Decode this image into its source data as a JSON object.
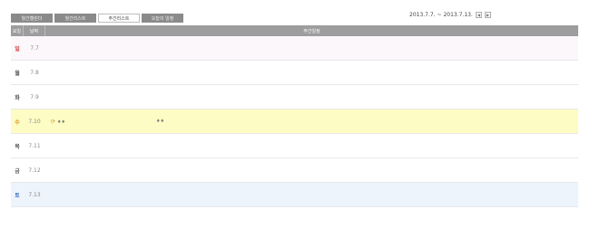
{
  "tabs": [
    {
      "label": "월간캘린더",
      "active": false
    },
    {
      "label": "월간리스트",
      "active": false
    },
    {
      "label": "주간리스트",
      "active": true
    },
    {
      "label": "오늘의 일정",
      "active": false
    }
  ],
  "range": {
    "text": "2013.7.7. ~ 2013.7.13.",
    "prev_icon": "chevron-left",
    "next_icon": "chevron-right"
  },
  "table": {
    "headers": {
      "dow": "요일",
      "date": "날짜",
      "schedule": "주간일정"
    },
    "rows": [
      {
        "dow": "일",
        "date": "7.7",
        "color": "#d33c3c",
        "bg": "sun"
      },
      {
        "dow": "월",
        "date": "7.8",
        "color": "#555555",
        "bg": "none"
      },
      {
        "dow": "화",
        "date": "7.9",
        "color": "#555555",
        "bg": "none"
      },
      {
        "dow": "수",
        "date": "7.10",
        "color": "#e08a1a",
        "bg": "today",
        "event1": "♦♦",
        "event2": "♦♦"
      },
      {
        "dow": "목",
        "date": "7.11",
        "color": "#555555",
        "bg": "none"
      },
      {
        "dow": "금",
        "date": "7.12",
        "color": "#555555",
        "bg": "none"
      },
      {
        "dow": "토",
        "date": "7.13",
        "color": "#3a6fc7",
        "bg": "sat"
      }
    ]
  }
}
